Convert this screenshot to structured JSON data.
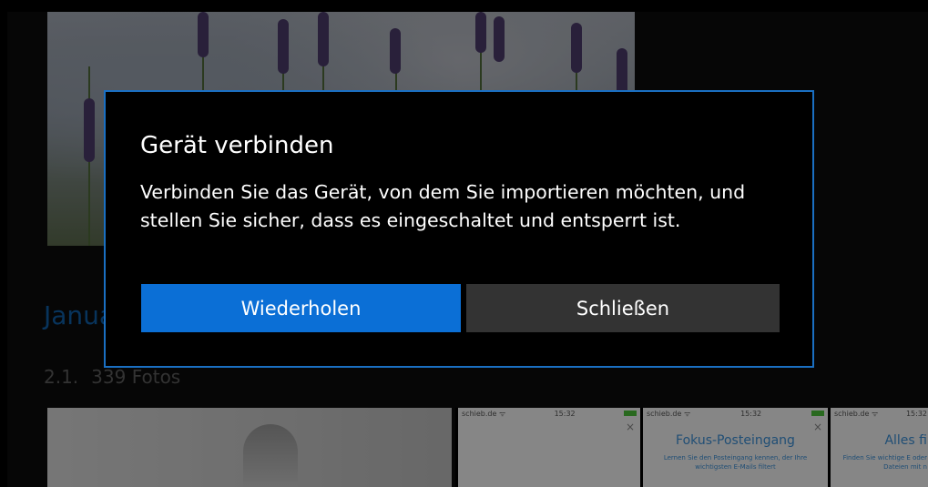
{
  "background": {
    "section_title": "Januar",
    "group_date": "2.1.",
    "group_count": "339 Fotos",
    "phones": [
      {
        "status_left": "schieb.de ᯤ",
        "time": "15:32",
        "title": "",
        "text": "",
        "close": "×"
      },
      {
        "status_left": "schieb.de ᯤ",
        "time": "15:32",
        "title": "Fokus-Posteingang",
        "text": "Lernen Sie den Posteingang kennen, der Ihre wichtigsten E-Mails filtert",
        "close": "×"
      },
      {
        "status_left": "schieb.de ᯤ",
        "time": "15:32",
        "title": "Alles fi",
        "text": "Finden Sie wichtige E oder Dateien mit n",
        "close": ""
      }
    ]
  },
  "dialog": {
    "title": "Gerät verbinden",
    "message": "Verbinden Sie das Gerät, von dem Sie importieren möchten, und stellen Sie sicher, dass es eingeschaltet und entsperrt ist.",
    "retry_label": "Wiederholen",
    "close_label": "Schließen"
  },
  "colors": {
    "accent": "#0b6fd6",
    "dialog_border": "#1a6fc2",
    "secondary_button": "#333333"
  }
}
